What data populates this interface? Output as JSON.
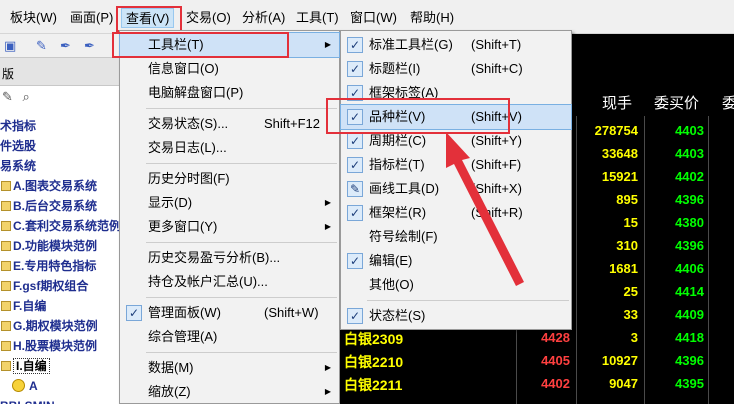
{
  "menubar": {
    "items": [
      "板块(W)",
      "画面(P)",
      "查看(V)",
      "交易(O)",
      "分析(A)",
      "工具(T)",
      "窗口(W)",
      "帮助(H)"
    ]
  },
  "left_panel": {
    "tab_label": "版",
    "tree": [
      {
        "label": "术指标",
        "type": "plain"
      },
      {
        "label": "件选股",
        "type": "plain"
      },
      {
        "label": "易系统",
        "type": "plain"
      },
      {
        "label": "A.图表交易系统",
        "type": "folder"
      },
      {
        "label": "B.后台交易系统",
        "type": "folder"
      },
      {
        "label": "C.套利交易系统范例",
        "type": "folder"
      },
      {
        "label": "D.功能模块范例",
        "type": "folder"
      },
      {
        "label": "E.专用特色指标",
        "type": "folder"
      },
      {
        "label": "F.gsf期权组合",
        "type": "folder"
      },
      {
        "label": "F.自编",
        "type": "folder"
      },
      {
        "label": "G.期权模块范例",
        "type": "folder"
      },
      {
        "label": "H.股票模块范例",
        "type": "folder"
      },
      {
        "label": "I.自编",
        "type": "folder-selected"
      },
      {
        "label": "A",
        "type": "smile"
      },
      {
        "label": "BBLSMIN",
        "type": "plain"
      }
    ]
  },
  "view_menu": {
    "items": [
      {
        "label": "工具栏(T)",
        "submenu": true,
        "highlight": true
      },
      {
        "label": "信息窗口(O)"
      },
      {
        "label": "电脑解盘窗口(P)"
      },
      {
        "sep": true
      },
      {
        "label": "交易状态(S)...",
        "shortcut": "Shift+F12"
      },
      {
        "label": "交易日志(L)..."
      },
      {
        "sep": true
      },
      {
        "label": "历史分时图(F)"
      },
      {
        "label": "显示(D)",
        "submenu": true
      },
      {
        "label": "更多窗口(Y)",
        "submenu": true
      },
      {
        "sep": true
      },
      {
        "label": "历史交易盈亏分析(B)..."
      },
      {
        "label": "持仓及帐户汇总(U)..."
      },
      {
        "sep": true
      },
      {
        "label": "管理面板(W)",
        "shortcut": "(Shift+W)",
        "checked": true
      },
      {
        "label": "综合管理(A)"
      },
      {
        "sep": true
      },
      {
        "label": "数据(M)",
        "submenu": true
      },
      {
        "label": "缩放(Z)",
        "submenu": true
      }
    ]
  },
  "toolbar_submenu": {
    "items": [
      {
        "label": "标准工具栏(G)",
        "shortcut": "(Shift+T)",
        "checked": true
      },
      {
        "label": "标题栏(I)",
        "shortcut": "(Shift+C)",
        "checked": true
      },
      {
        "label": "框架标签(A)",
        "checked": true
      },
      {
        "label": "品种栏(V)",
        "shortcut": "(Shift+V)",
        "checked": true,
        "highlight": true
      },
      {
        "label": "周期栏(C)",
        "shortcut": "(Shift+Y)",
        "checked": true
      },
      {
        "label": "指标栏(T)",
        "shortcut": "(Shift+F)",
        "checked": true
      },
      {
        "label": "画线工具(D)",
        "shortcut": "(Shift+X)",
        "checked": true,
        "pencil": true
      },
      {
        "label": "框架栏(R)",
        "shortcut": "(Shift+R)",
        "checked": true
      },
      {
        "label": "符号绘制(F)"
      },
      {
        "label": "编辑(E)",
        "checked": true
      },
      {
        "label": "其他(O)"
      },
      {
        "sep": true
      },
      {
        "label": "状态栏(S)",
        "checked": true
      }
    ]
  },
  "quote_table": {
    "headers": [
      "现手",
      "委买价",
      "委"
    ],
    "rows": [
      {
        "name": "",
        "v1": "",
        "v2": "278754",
        "v3": "4403"
      },
      {
        "name": "",
        "v1": "",
        "v2": "33648",
        "v3": "4403"
      },
      {
        "name": "",
        "v1": "",
        "v2": "15921",
        "v3": "4402"
      },
      {
        "name": "",
        "v1": "",
        "v2": "895",
        "v3": "4396"
      },
      {
        "name": "",
        "v1": "",
        "v2": "15",
        "v3": "4380"
      },
      {
        "name": "",
        "v1": "",
        "v2": "310",
        "v3": "4396"
      },
      {
        "name": "",
        "v1": "",
        "v2": "1681",
        "v3": "4406"
      },
      {
        "name": "",
        "v1": "",
        "v2": "25",
        "v3": "4414"
      },
      {
        "name": "",
        "v1": "",
        "v2": "33",
        "v3": "4409"
      },
      {
        "name": "白银2309",
        "v1": "4428",
        "v2": "3",
        "v3": "4418"
      },
      {
        "name": "白银2210",
        "v1": "4405",
        "v2": "10927",
        "v3": "4396"
      },
      {
        "name": "白银2211",
        "v1": "4402",
        "v2": "9047",
        "v3": "4395"
      }
    ]
  },
  "colors": {
    "name": "#ffff00",
    "v1": "#ff4040",
    "v2": "#ffff00",
    "v3": "#00ff00",
    "annotation_red": "#e3303a"
  }
}
